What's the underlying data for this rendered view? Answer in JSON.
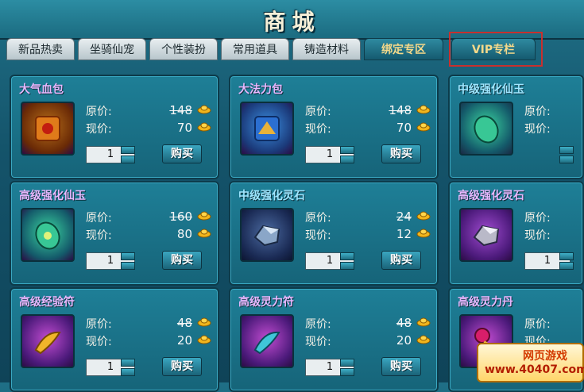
{
  "header": {
    "title": "商城"
  },
  "tabs": [
    {
      "label": "新品热卖"
    },
    {
      "label": "坐骑仙宠"
    },
    {
      "label": "个性装扮"
    },
    {
      "label": "常用道具"
    },
    {
      "label": "铸造材料"
    },
    {
      "label": "绑定专区"
    },
    {
      "label": "VIP专栏"
    }
  ],
  "labels": {
    "original": "原价:",
    "current": "现价:",
    "buy": "购买"
  },
  "items": [
    {
      "name": "大气血包",
      "orig": "148",
      "now": "70",
      "qty": "1",
      "icon": "health-pack-icon"
    },
    {
      "name": "大法力包",
      "orig": "148",
      "now": "70",
      "qty": "1",
      "icon": "mana-pack-icon"
    },
    {
      "name": "中级强化仙玉",
      "orig": "",
      "now": "",
      "qty": "",
      "icon": "jade-icon"
    },
    {
      "name": "高级强化仙玉",
      "orig": "160",
      "now": "80",
      "qty": "1",
      "icon": "jade-icon"
    },
    {
      "name": "中级强化灵石",
      "orig": "24",
      "now": "12",
      "qty": "1",
      "icon": "spirit-stone-icon"
    },
    {
      "name": "高级强化灵石",
      "orig": "",
      "now": "",
      "qty": "1",
      "icon": "spirit-stone-icon"
    },
    {
      "name": "高级经验符",
      "orig": "48",
      "now": "20",
      "qty": "1",
      "icon": "exp-talisman-icon"
    },
    {
      "name": "高级灵力符",
      "orig": "48",
      "now": "20",
      "qty": "1",
      "icon": "power-talisman-icon"
    },
    {
      "name": "高级灵力丹",
      "orig": "",
      "now": "",
      "qty": "",
      "icon": "elixir-icon"
    }
  ],
  "watermark": {
    "line1": "网页游戏",
    "line2": "www.40407.com"
  },
  "colors": {
    "accent": "#1e7f97",
    "tab_active_text": "#f5d98a",
    "highlight": "#c8302e"
  }
}
